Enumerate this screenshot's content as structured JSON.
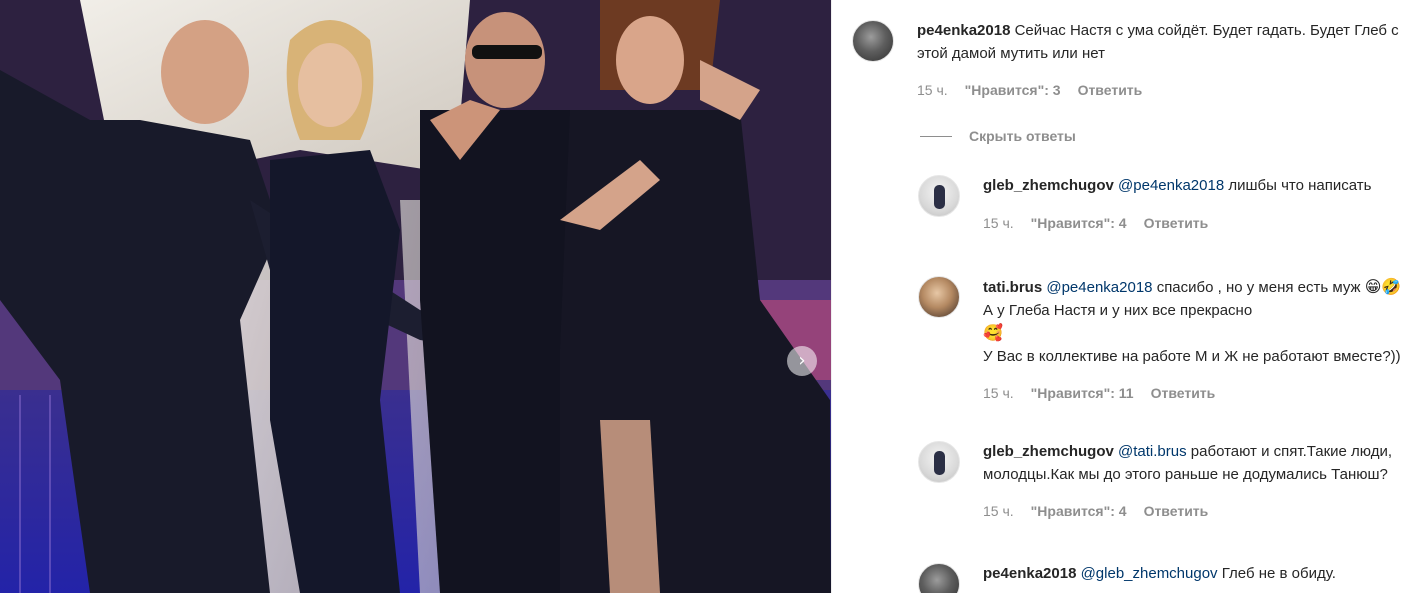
{
  "post": {
    "next_icon": "chevron-right-icon",
    "next_symbol": "›"
  },
  "comments": [
    {
      "username": "pe4enka2018",
      "mention": "",
      "text": "Сейчас Настя с ума сойдёт. Будет гадать. Будет Глеб с этой дамой мутить или нет",
      "time": "15 ч.",
      "likes": "\"Нравится\": 3",
      "reply": "Ответить"
    }
  ],
  "hide_replies": "Скрыть ответы",
  "replies": [
    {
      "username": "gleb_zhemchugov",
      "mention": "@pe4enka2018",
      "text": "лишбы что написать",
      "time": "15 ч.",
      "likes": "\"Нравится\": 4",
      "reply": "Ответить"
    },
    {
      "username": "tati.brus",
      "mention": "@pe4enka2018",
      "text_1": "спасибо , но у меня есть муж",
      "emoji_1": "😁🤣",
      "text_2": "А у Глеба Настя и у них все прекрасно",
      "emoji_2": "🥰",
      "text_3": "У Вас в коллективе на работе М и Ж не работают вместе?))",
      "time": "15 ч.",
      "likes": "\"Нравится\": 11",
      "reply": "Ответить"
    },
    {
      "username": "gleb_zhemchugov",
      "mention": "@tati.brus",
      "text": "работают и спят.Такие люди, молодцы.Как мы до этого раньше не додумались Танюш?",
      "time": "15 ч.",
      "likes": "\"Нравится\": 4",
      "reply": "Ответить"
    },
    {
      "username": "pe4enka2018",
      "mention": "@gleb_zhemchugov",
      "text": "Глеб не в обиду."
    }
  ]
}
